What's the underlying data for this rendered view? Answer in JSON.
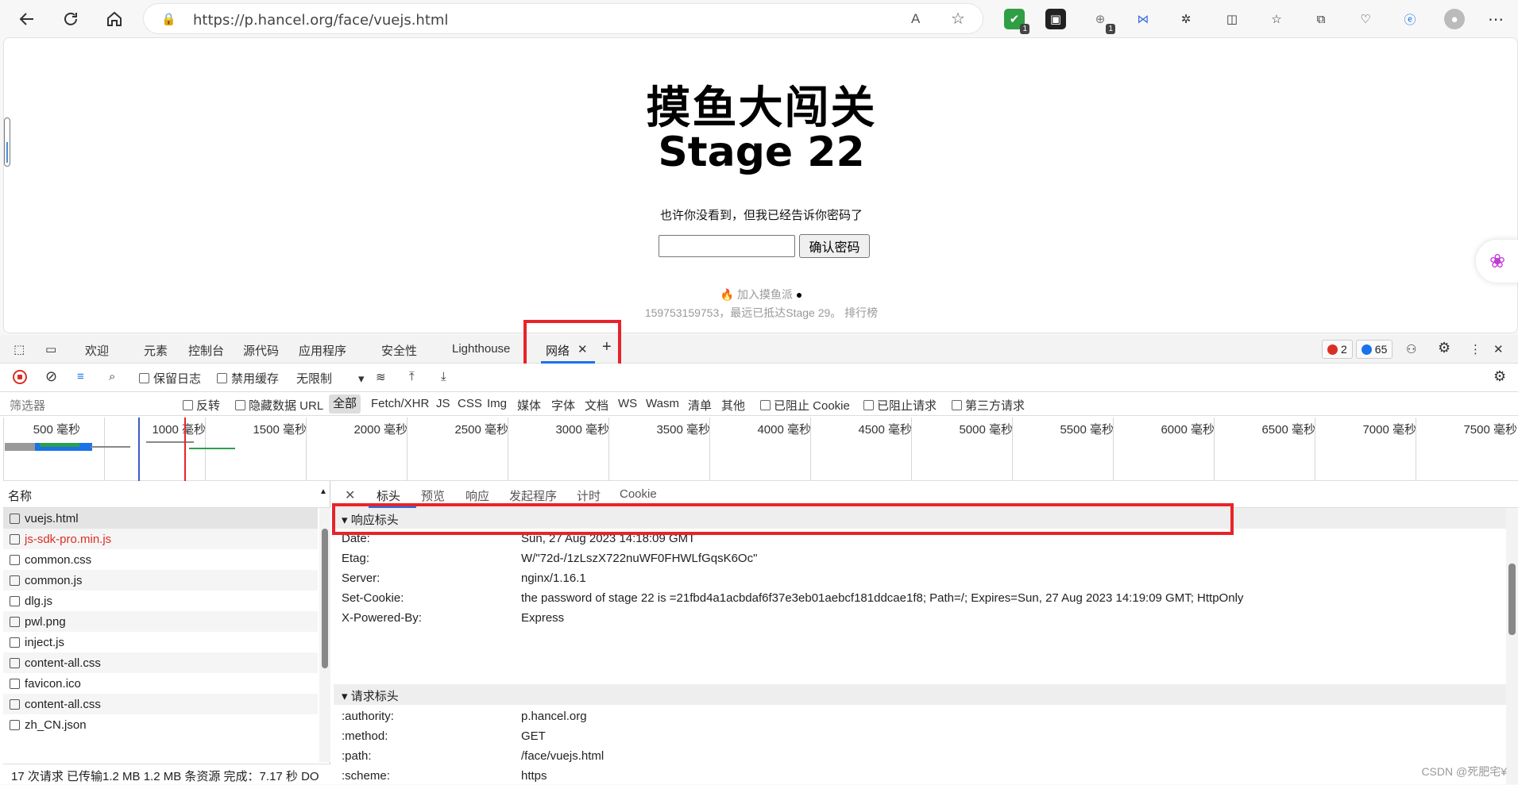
{
  "browser": {
    "url": "https://p.hancel.org/face/vuejs.html",
    "read_aloud_icon": "A",
    "ext_badge_1": "1",
    "ext_badge_2": "1"
  },
  "page": {
    "title": "摸鱼大闯关",
    "stage": "Stage 22",
    "hint": "也许你没看到，但我已经告诉你密码了",
    "password_value": "",
    "confirm_button": "确认密码",
    "join_link": "加入摸鱼派",
    "footer": "159753159753，最远已抵达Stage 29。 排行榜"
  },
  "devtools": {
    "tabs": [
      "欢迎",
      "元素",
      "控制台",
      "源代码",
      "应用程序",
      "安全性",
      "Lighthouse",
      "网络"
    ],
    "error_count": "2",
    "message_count": "65",
    "network_toolbar": {
      "preserve_log": "保留日志",
      "disable_cache": "禁用缓存",
      "throttle": "无限制"
    },
    "filter": {
      "placeholder": "筛选器",
      "invert": "反转",
      "hide_data_url": "隐藏数据 URL",
      "all": "全部",
      "types": [
        "Fetch/XHR",
        "JS",
        "CSS",
        "Img",
        "媒体",
        "字体",
        "文档",
        "WS",
        "Wasm",
        "清单",
        "其他"
      ],
      "blocked_cookies": "已阻止 Cookie",
      "blocked_requests": "已阻止请求",
      "third_party": "第三方请求"
    },
    "timeline_labels": [
      "500 毫秒",
      "1000 毫秒",
      "1500 毫秒",
      "2000 毫秒",
      "2500 毫秒",
      "3000 毫秒",
      "3500 毫秒",
      "4000 毫秒",
      "4500 毫秒",
      "5000 毫秒",
      "5500 毫秒",
      "6000 毫秒",
      "6500 毫秒",
      "7000 毫秒",
      "7500 毫秒"
    ],
    "request_list": {
      "header": "名称",
      "rows": [
        {
          "name": "vuejs.html",
          "color": "#1f1f1f"
        },
        {
          "name": "js-sdk-pro.min.js",
          "color": "#d93025"
        },
        {
          "name": "common.css",
          "color": "#1f1f1f"
        },
        {
          "name": "common.js",
          "color": "#1f1f1f"
        },
        {
          "name": "dlg.js",
          "color": "#1f1f1f"
        },
        {
          "name": "pwl.png",
          "color": "#1f1f1f"
        },
        {
          "name": "inject.js",
          "color": "#1f1f1f"
        },
        {
          "name": "content-all.css",
          "color": "#1f1f1f"
        },
        {
          "name": "favicon.ico",
          "color": "#1f1f1f"
        },
        {
          "name": "content-all.css",
          "color": "#1f1f1f"
        },
        {
          "name": "zh_CN.json",
          "color": "#1f1f1f"
        }
      ],
      "status": "17 次请求  已传输1.2 MB  1.2 MB 条资源  完成：7.17 秒  DO"
    },
    "detail_tabs": [
      "标头",
      "预览",
      "响应",
      "发起程序",
      "计时",
      "Cookie"
    ],
    "response_headers_title": "▾ 响应标头",
    "response_headers": [
      {
        "key": "Date:",
        "value": "Sun, 27 Aug 2023 14:18:09 GMT"
      },
      {
        "key": "Etag:",
        "value": "W/\"72d-/1zLszX722nuWF0FHWLfGqsK6Oc\""
      },
      {
        "key": "Server:",
        "value": "nginx/1.16.1"
      },
      {
        "key": "Set-Cookie:",
        "value": "the password of stage 22 is =21fbd4a1acbdaf6f37e3eb01aebcf181ddcae1f8; Path=/; Expires=Sun, 27 Aug 2023 14:19:09 GMT; HttpOnly"
      },
      {
        "key": "X-Powered-By:",
        "value": "Express"
      }
    ],
    "request_headers_title": "▾ 请求标头",
    "request_headers": [
      {
        "key": ":authority:",
        "value": "p.hancel.org"
      },
      {
        "key": ":method:",
        "value": "GET"
      },
      {
        "key": ":path:",
        "value": "/face/vuejs.html"
      },
      {
        "key": ":scheme:",
        "value": "https"
      }
    ]
  },
  "watermark": "CSDN @死肥宅¥",
  "colors": {
    "highlight_box": "#e8232a",
    "accent": "#1a73e8"
  }
}
